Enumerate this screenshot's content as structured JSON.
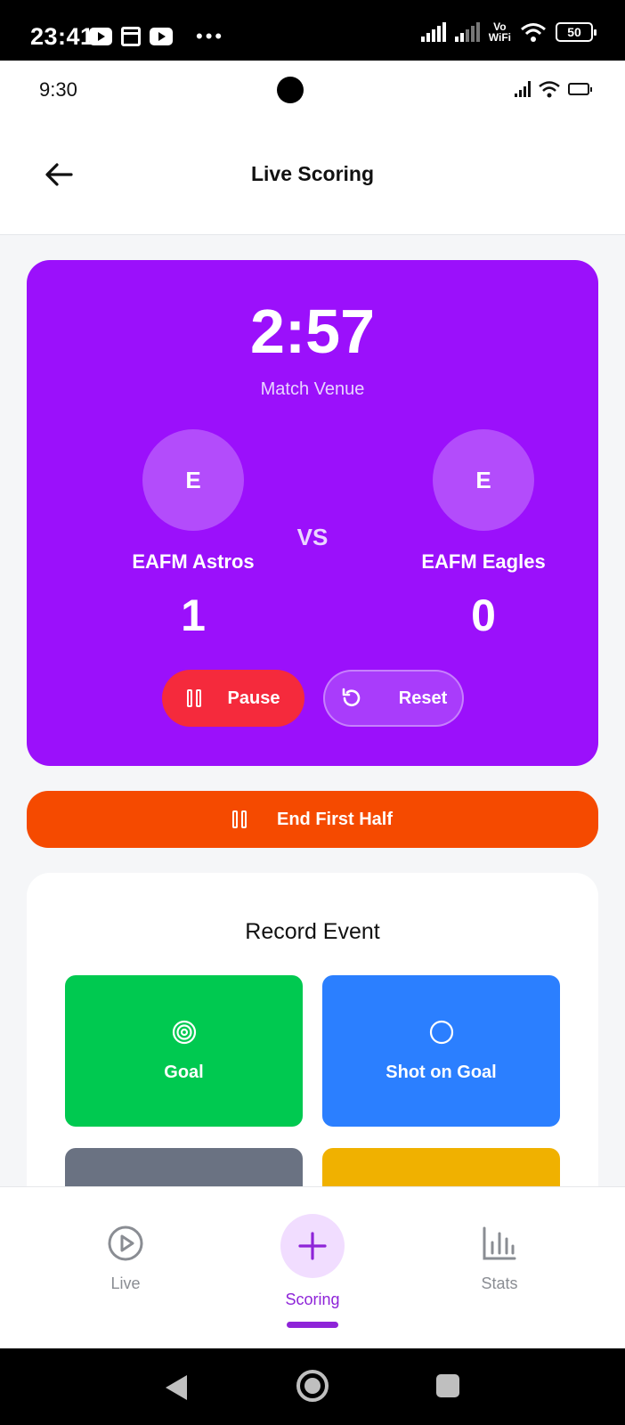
{
  "system_status": {
    "time": "23:41",
    "vowifi_line1": "Vo",
    "vowifi_line2": "WiFi",
    "battery": "50"
  },
  "device_status": {
    "time": "9:30"
  },
  "header": {
    "title": "Live Scoring"
  },
  "match": {
    "clock": "2:57",
    "venue": "Match Venue",
    "vs_label": "VS",
    "home": {
      "initial": "E",
      "name": "EAFM Astros",
      "score": "1"
    },
    "away": {
      "initial": "E",
      "name": "EAFM Eagles",
      "score": "0"
    },
    "pause_label": "Pause",
    "reset_label": "Reset"
  },
  "end_half_label": "End First Half",
  "record_event": {
    "title": "Record Event",
    "events": [
      {
        "label": "Goal",
        "icon": "target-icon",
        "color": "#00c950"
      },
      {
        "label": "Shot on Goal",
        "icon": "circle-icon",
        "color": "#2b7fff"
      },
      {
        "label": "",
        "color": "#6a7282"
      },
      {
        "label": "",
        "color": "#f0b100"
      }
    ]
  },
  "bottom_nav": {
    "items": [
      {
        "label": "Live",
        "icon": "play-circle-icon",
        "active": false
      },
      {
        "label": "Scoring",
        "icon": "plus-icon",
        "active": true
      },
      {
        "label": "Stats",
        "icon": "bar-chart-icon",
        "active": false
      }
    ],
    "active_color": "#8e24d8"
  },
  "colors": {
    "score_card": "#9b10fb",
    "pause": "#f52a3c",
    "end_half": "#f54a00"
  }
}
